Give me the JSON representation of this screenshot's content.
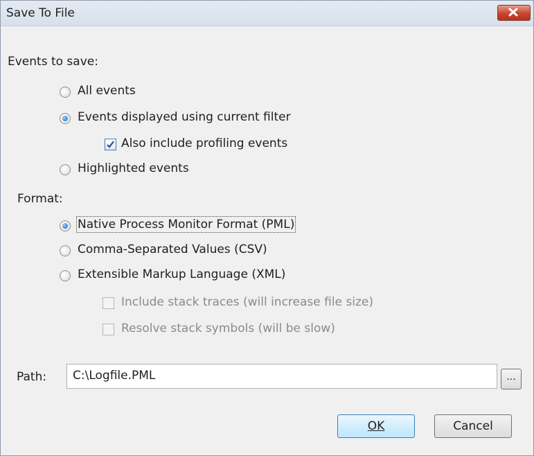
{
  "window": {
    "title": "Save To File",
    "close_label": "close"
  },
  "events_section": {
    "heading": "Events to save:",
    "options": [
      {
        "label": "All events",
        "selected": false
      },
      {
        "label": "Events displayed using current filter",
        "selected": true
      },
      {
        "label": "Highlighted events",
        "selected": false
      }
    ],
    "include_profiling": {
      "label": "Also include profiling events",
      "checked": true
    }
  },
  "format_section": {
    "heading": "Format:",
    "options": [
      {
        "label": "Native Process Monitor Format (PML)",
        "selected": true
      },
      {
        "label": "Comma-Separated Values (CSV)",
        "selected": false
      },
      {
        "label": "Extensible Markup Language (XML)",
        "selected": false
      }
    ],
    "xml_options": [
      {
        "label": "Include stack traces (will increase file size)",
        "checked": false,
        "enabled": false
      },
      {
        "label": "Resolve stack symbols (will be slow)",
        "checked": false,
        "enabled": false
      }
    ]
  },
  "path": {
    "label": "Path:",
    "value": "C:\\Logfile.PML",
    "browse_label": "..."
  },
  "buttons": {
    "ok": "OK",
    "cancel": "Cancel"
  }
}
